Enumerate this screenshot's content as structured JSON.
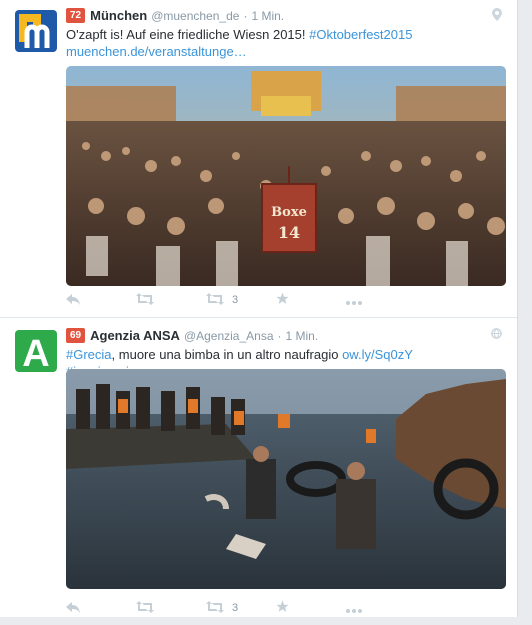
{
  "tweets": [
    {
      "badge": "72",
      "name": "München",
      "handle": "@muenchen_de",
      "dot": "·",
      "time": "1 Min.",
      "text_plain": "O'zapft is! Auf eine friedliche Wiesn 2015! ",
      "hashtag": "#Oktoberfest2015",
      "link": " muenchen.de/veranstaltunge…",
      "sign": "Boxe 14",
      "retweet_count": "3",
      "top_icon": "location-pin-icon"
    },
    {
      "badge": "69",
      "name": "Agenzia ANSA",
      "handle": "@Agenzia_Ansa",
      "dot": "·",
      "time": "1 Min.",
      "hashtag1": "#Grecia",
      "text_plain": ", muore una bimba in un altro naufragio ",
      "link": "ow.ly/Sq0zY",
      "hashtag2": " #immigrazione",
      "logo_letter": "A",
      "retweet_count": "3",
      "top_icon": "globe-icon"
    }
  ],
  "colors": {
    "link": "#3b94d9",
    "badge": "#e0533f",
    "muted": "#8899a6",
    "ansa_green": "#2eaa4a",
    "muenchen_blue": "#1f5aa8"
  }
}
